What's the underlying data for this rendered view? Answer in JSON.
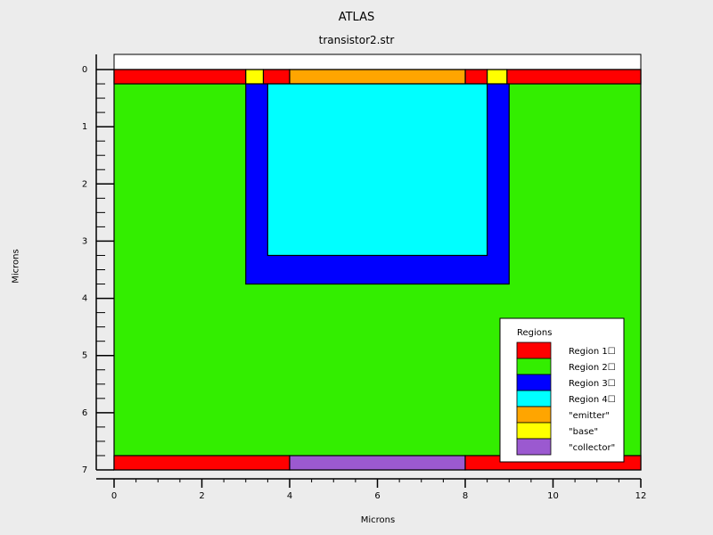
{
  "chart_data": {
    "type": "region_map",
    "title": "ATLAS",
    "subtitle": "transistor2.str",
    "xlabel": "Microns",
    "ylabel": "Microns",
    "xlim": [
      0,
      12
    ],
    "ylim": [
      0,
      7
    ],
    "y_inverted": true,
    "xticks": [
      0,
      2,
      4,
      6,
      8,
      10,
      12
    ],
    "yticks": [
      0,
      1,
      2,
      3,
      4,
      5,
      6,
      7
    ],
    "x_minor_step": 0.5,
    "y_minor_step": 0.25,
    "top_margin_to": 0,
    "background_above_zero": "#ffffff",
    "rectangles": [
      {
        "name": "region-2-substrate",
        "region": 2,
        "x": [
          0,
          12
        ],
        "y": [
          0,
          7
        ]
      },
      {
        "name": "region-1-top-left",
        "region": 1,
        "x": [
          0,
          3.0
        ],
        "y": [
          0,
          0.25
        ]
      },
      {
        "name": "region-1-top-between-left",
        "region": 1,
        "x": [
          3.4,
          4.0
        ],
        "y": [
          0,
          0.25
        ]
      },
      {
        "name": "region-1-top-between-right",
        "region": 1,
        "x": [
          8.0,
          8.5
        ],
        "y": [
          0,
          0.25
        ]
      },
      {
        "name": "region-1-top-right",
        "region": 1,
        "x": [
          8.95,
          12
        ],
        "y": [
          0,
          0.25
        ]
      },
      {
        "name": "base-left",
        "region": "base",
        "x": [
          3.0,
          3.4
        ],
        "y": [
          0,
          0.25
        ]
      },
      {
        "name": "base-right",
        "region": "base",
        "x": [
          8.5,
          8.95
        ],
        "y": [
          0,
          0.25
        ]
      },
      {
        "name": "emitter-contact",
        "region": "emitter",
        "x": [
          4.0,
          8.0
        ],
        "y": [
          0,
          0.25
        ]
      },
      {
        "name": "region-3-well",
        "region": 3,
        "x": [
          3.0,
          9.0
        ],
        "y": [
          0.25,
          3.75
        ]
      },
      {
        "name": "region-4-core",
        "region": 4,
        "x": [
          3.5,
          8.5
        ],
        "y": [
          0.25,
          3.25
        ]
      },
      {
        "name": "region-1-bottom-left",
        "region": 1,
        "x": [
          0,
          4.0
        ],
        "y": [
          6.75,
          7
        ]
      },
      {
        "name": "collector-contact",
        "region": "collector",
        "x": [
          4.0,
          8.0
        ],
        "y": [
          6.75,
          7
        ]
      },
      {
        "name": "region-1-bottom-right",
        "region": 1,
        "x": [
          8.0,
          12
        ],
        "y": [
          6.75,
          7
        ]
      }
    ],
    "legend": {
      "title": "Regions",
      "placement": "bottom-right",
      "entries": [
        {
          "label": "Region 1☐",
          "color": "#ff0000"
        },
        {
          "label": "Region 2☐",
          "color": "#33ee00"
        },
        {
          "label": "Region 3☐",
          "color": "#0000ff"
        },
        {
          "label": "Region 4☐",
          "color": "#00ffff"
        },
        {
          "label": "\"emitter\"",
          "color": "#ffa500"
        },
        {
          "label": "\"base\"",
          "color": "#ffff00"
        },
        {
          "label": "\"collector\"",
          "color": "#9b59d0"
        }
      ]
    },
    "colors": {
      "1": "#ff0000",
      "2": "#33ee00",
      "3": "#0000ff",
      "4": "#00ffff",
      "emitter": "#ffa500",
      "base": "#ffff00",
      "collector": "#9b59d0"
    }
  }
}
